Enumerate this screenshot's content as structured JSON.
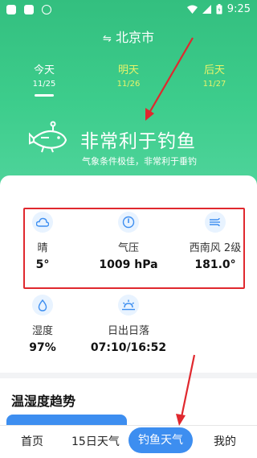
{
  "status_bar": {
    "time": "9:25"
  },
  "header": {
    "city": "北京市",
    "swap_icon": "⇋"
  },
  "days": [
    {
      "name": "今天",
      "date": "11/25"
    },
    {
      "name": "明天",
      "date": "11/26"
    },
    {
      "name": "后天",
      "date": "11/27"
    }
  ],
  "verdict": {
    "title": "非常利于钓鱼",
    "subtitle": "气象条件极佳，非常利于垂钓"
  },
  "metrics": {
    "weather": {
      "label": "晴",
      "value": "5°",
      "icon": "cloud-icon"
    },
    "pressure": {
      "label": "气压",
      "value": "1009 hPa",
      "icon": "gauge-icon"
    },
    "wind": {
      "label": "西南风 2级",
      "value": "181.0°",
      "icon": "wind-icon"
    },
    "humidity": {
      "label": "湿度",
      "value": "97%",
      "icon": "droplet-icon"
    },
    "sun": {
      "label": "日出日落",
      "value": "07:10/16:52",
      "icon": "sunrise-icon"
    }
  },
  "trend": {
    "title": "温湿度趋势"
  },
  "tabs": {
    "home": "首页",
    "forecast15": "15日天气",
    "fishing": "钓鱼天气",
    "mine": "我的"
  },
  "colors": {
    "header_green": "#3dcd8c",
    "accent_blue": "#3d8ef0",
    "highlight_red": "#e0282e",
    "tab_yellow": "#e9f36a"
  }
}
